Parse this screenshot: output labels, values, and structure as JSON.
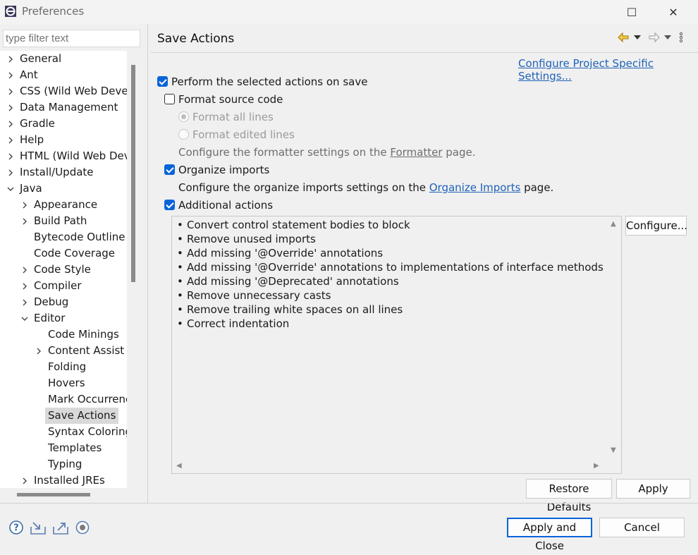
{
  "window": {
    "title": "Preferences",
    "maximize_glyph": "☐",
    "close_glyph": "✕"
  },
  "sidebar": {
    "filter_placeholder": "type filter text",
    "items": [
      {
        "label": "General",
        "expandable": true,
        "expanded": false
      },
      {
        "label": "Ant",
        "expandable": true,
        "expanded": false
      },
      {
        "label": "CSS (Wild Web Develo",
        "expandable": true,
        "expanded": false
      },
      {
        "label": "Data Management",
        "expandable": true,
        "expanded": false
      },
      {
        "label": "Gradle",
        "expandable": true,
        "expanded": false
      },
      {
        "label": "Help",
        "expandable": true,
        "expanded": false
      },
      {
        "label": "HTML (Wild Web Deve",
        "expandable": true,
        "expanded": false
      },
      {
        "label": "Install/Update",
        "expandable": true,
        "expanded": false
      },
      {
        "label": "Java",
        "expandable": true,
        "expanded": true
      },
      {
        "label": "Appearance",
        "expandable": true,
        "expanded": false
      },
      {
        "label": "Build Path",
        "expandable": true,
        "expanded": false
      },
      {
        "label": "Bytecode Outline",
        "expandable": false
      },
      {
        "label": "Code Coverage",
        "expandable": false
      },
      {
        "label": "Code Style",
        "expandable": true,
        "expanded": false
      },
      {
        "label": "Compiler",
        "expandable": true,
        "expanded": false
      },
      {
        "label": "Debug",
        "expandable": true,
        "expanded": false
      },
      {
        "label": "Editor",
        "expandable": true,
        "expanded": true
      },
      {
        "label": "Code Minings",
        "expandable": false
      },
      {
        "label": "Content Assist",
        "expandable": true,
        "expanded": false
      },
      {
        "label": "Folding",
        "expandable": false
      },
      {
        "label": "Hovers",
        "expandable": false
      },
      {
        "label": "Mark Occurrenc",
        "expandable": false
      },
      {
        "label": "Save Actions",
        "expandable": false,
        "selected": true
      },
      {
        "label": "Syntax Coloring",
        "expandable": false
      },
      {
        "label": "Templates",
        "expandable": false
      },
      {
        "label": "Typing",
        "expandable": false
      },
      {
        "label": "Installed JREs",
        "expandable": true,
        "expanded": false
      }
    ]
  },
  "main": {
    "title": "Save Actions",
    "project_link": "Configure Project Specific Settings...",
    "perform_on_save": {
      "label": "Perform the selected actions on save",
      "checked": true
    },
    "format_source": {
      "label": "Format source code",
      "checked": false
    },
    "format_all_lines": {
      "label": "Format all lines",
      "selected": true,
      "enabled": false
    },
    "format_edited_lines": {
      "label": "Format edited lines",
      "selected": false,
      "enabled": false
    },
    "formatter_note": {
      "prefix": "Configure the formatter settings on the ",
      "link": "Formatter",
      "suffix": " page."
    },
    "organize_imports": {
      "label": "Organize imports",
      "checked": true
    },
    "organize_note": {
      "prefix": "Configure the organize imports settings on the ",
      "link": "Organize Imports",
      "suffix": " page."
    },
    "additional_actions": {
      "label": "Additional actions",
      "checked": true
    },
    "bullet": "•",
    "actions": [
      "Convert control statement bodies to block",
      "Remove unused imports",
      "Add missing '@Override' annotations",
      "Add missing '@Override' annotations to implementations of interface methods",
      "Add missing '@Deprecated' annotations",
      "Remove unnecessary casts",
      "Remove trailing white spaces on all lines",
      "Correct indentation"
    ],
    "configure_button": "Configure...",
    "restore_defaults_button": "Restore Defaults",
    "apply_button": "Apply"
  },
  "footer": {
    "apply_close_button": "Apply and Close",
    "cancel_button": "Cancel"
  },
  "colors": {
    "accent": "#0a64d8",
    "link": "#1e62b8",
    "selection": "#d9d9d9"
  }
}
